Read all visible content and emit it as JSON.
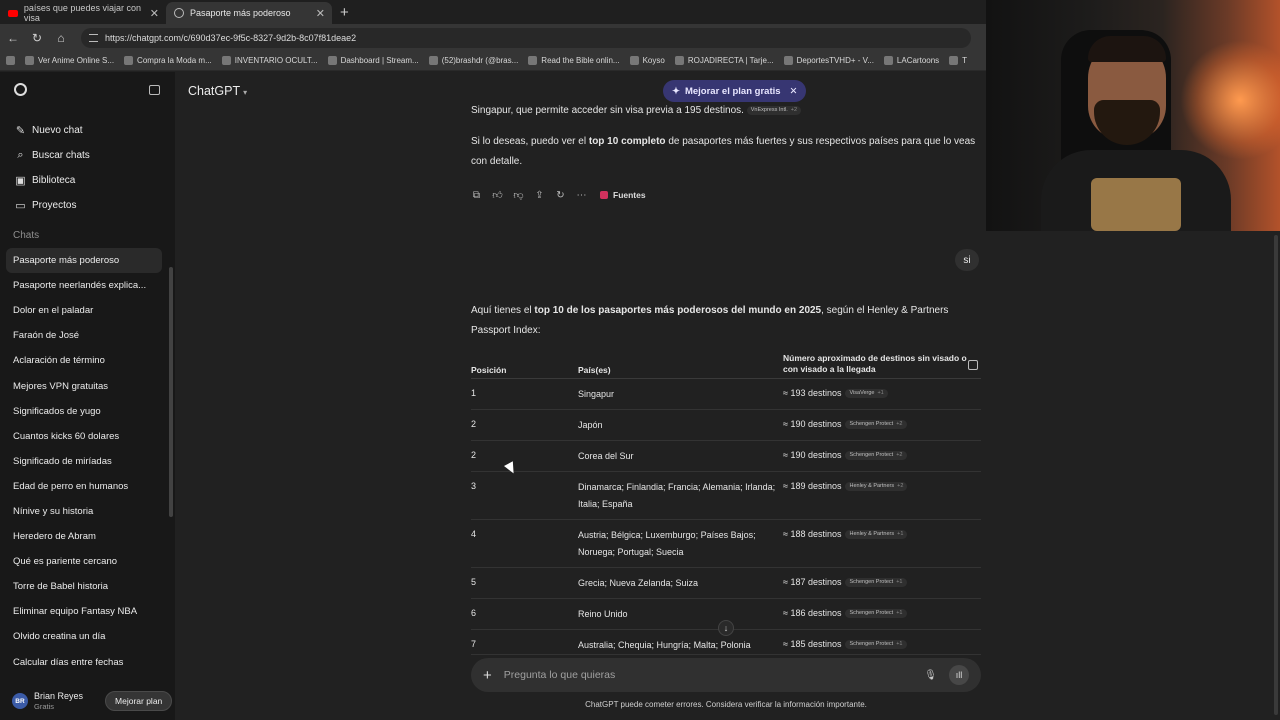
{
  "browser": {
    "tabs": [
      {
        "title": "países que puedes viajar con visa",
        "active": false
      },
      {
        "title": "Pasaporte más poderoso",
        "active": true
      }
    ],
    "url": "https://chatgpt.com/c/690d37ec-9f5c-8327-9d2b-8c07f81deae2",
    "bookmarks": [
      "Ver Anime Online S...",
      "Compra la Moda m...",
      "INVENTARIO OCULT...",
      "Dashboard | Stream...",
      "(52)brashdr (@bras...",
      "Read the Bible onlin...",
      "Koyso",
      "ROJADIRECTA | Tarje...",
      "DeportesTVHD+ - V...",
      "LACartoons",
      "T"
    ]
  },
  "sidebar": {
    "menu": [
      {
        "icon": "new-chat-icon",
        "label": "Nuevo chat"
      },
      {
        "icon": "search-icon",
        "label": "Buscar chats"
      },
      {
        "icon": "library-icon",
        "label": "Biblioteca"
      },
      {
        "icon": "folder-icon",
        "label": "Proyectos"
      }
    ],
    "section": "Chats",
    "chats": [
      "Pasaporte más poderoso",
      "Pasaporte neerlandés explica...",
      "Dolor en el paladar",
      "Faraón de José",
      "Aclaración de término",
      "Mejores VPN gratuitas",
      "Significados de yugo",
      "Cuantos kicks 60 dolares",
      "Significado de miríadas",
      "Edad de perro en humanos",
      "Nínive y su historia",
      "Heredero de Abram",
      "Qué es pariente cercano",
      "Torre de Babel historia",
      "Eliminar equipo Fantasy NBA",
      "Olvido creatina un día",
      "Calcular días entre fechas"
    ],
    "user": {
      "initials": "BR",
      "name": "Brian Reyes",
      "plan": "Gratis",
      "upgrade": "Mejorar plan"
    }
  },
  "header": {
    "model": "ChatGPT",
    "promo": "Mejorar el plan gratis"
  },
  "conversation": {
    "p1_text": "Singapur, que permite acceder sin visa previa a 195 destinos.",
    "p1_chip": "VnExpress Intl.",
    "p1_chip_count": "+2",
    "p2_a": "Si lo deseas, puedo ver el ",
    "p2_b": "top 10 completo",
    "p2_c": " de pasaportes más fuertes y sus respectivos países para que lo veas con detalle.",
    "sources": "Fuentes",
    "user_msg": "si",
    "p3_a": "Aquí tienes el ",
    "p3_b": "top 10 de los pasaportes más poderosos del mundo en 2025",
    "p3_c": ", según el Henley & Partners Passport Index:"
  },
  "table": {
    "headers": [
      "Posición",
      "País(es)",
      "Número aproximado de destinos sin visado o con visado a la llegada"
    ],
    "rows": [
      {
        "pos": "1",
        "countries": "Singapur",
        "dest": "≈ 193 destinos",
        "src": "VisaVerge",
        "more": "+1"
      },
      {
        "pos": "2",
        "countries": "Japón",
        "dest": "≈ 190 destinos",
        "src": "Schengen Protect",
        "more": "+2"
      },
      {
        "pos": "2",
        "countries": "Corea del Sur",
        "dest": "≈ 190 destinos",
        "src": "Schengen Protect",
        "more": "+2"
      },
      {
        "pos": "3",
        "countries": "Dinamarca; Finlandia; Francia; Alemania; Irlanda; Italia; España",
        "dest": "≈ 189 destinos",
        "src": "Henley & Partners",
        "more": "+2"
      },
      {
        "pos": "4",
        "countries": "Austria; Bélgica; Luxemburgo; Países Bajos; Noruega; Portugal; Suecia",
        "dest": "≈ 188 destinos",
        "src": "Henley & Partners",
        "more": "+1"
      },
      {
        "pos": "5",
        "countries": "Grecia; Nueva Zelanda; Suiza",
        "dest": "≈ 187 destinos",
        "src": "Schengen Protect",
        "more": "+1"
      },
      {
        "pos": "6",
        "countries": "Reino Unido",
        "dest": "≈ 186 destinos",
        "src": "Schengen Protect",
        "more": "+1"
      },
      {
        "pos": "7",
        "countries": "Australia; Chequia; Hungría; Malta; Polonia",
        "dest": "≈ 185 destinos",
        "src": "Schengen Protect",
        "more": "+1"
      }
    ]
  },
  "composer": {
    "placeholder": "Pregunta lo que quieras",
    "disclaimer": "ChatGPT puede cometer errores. Considera verificar la información importante."
  }
}
